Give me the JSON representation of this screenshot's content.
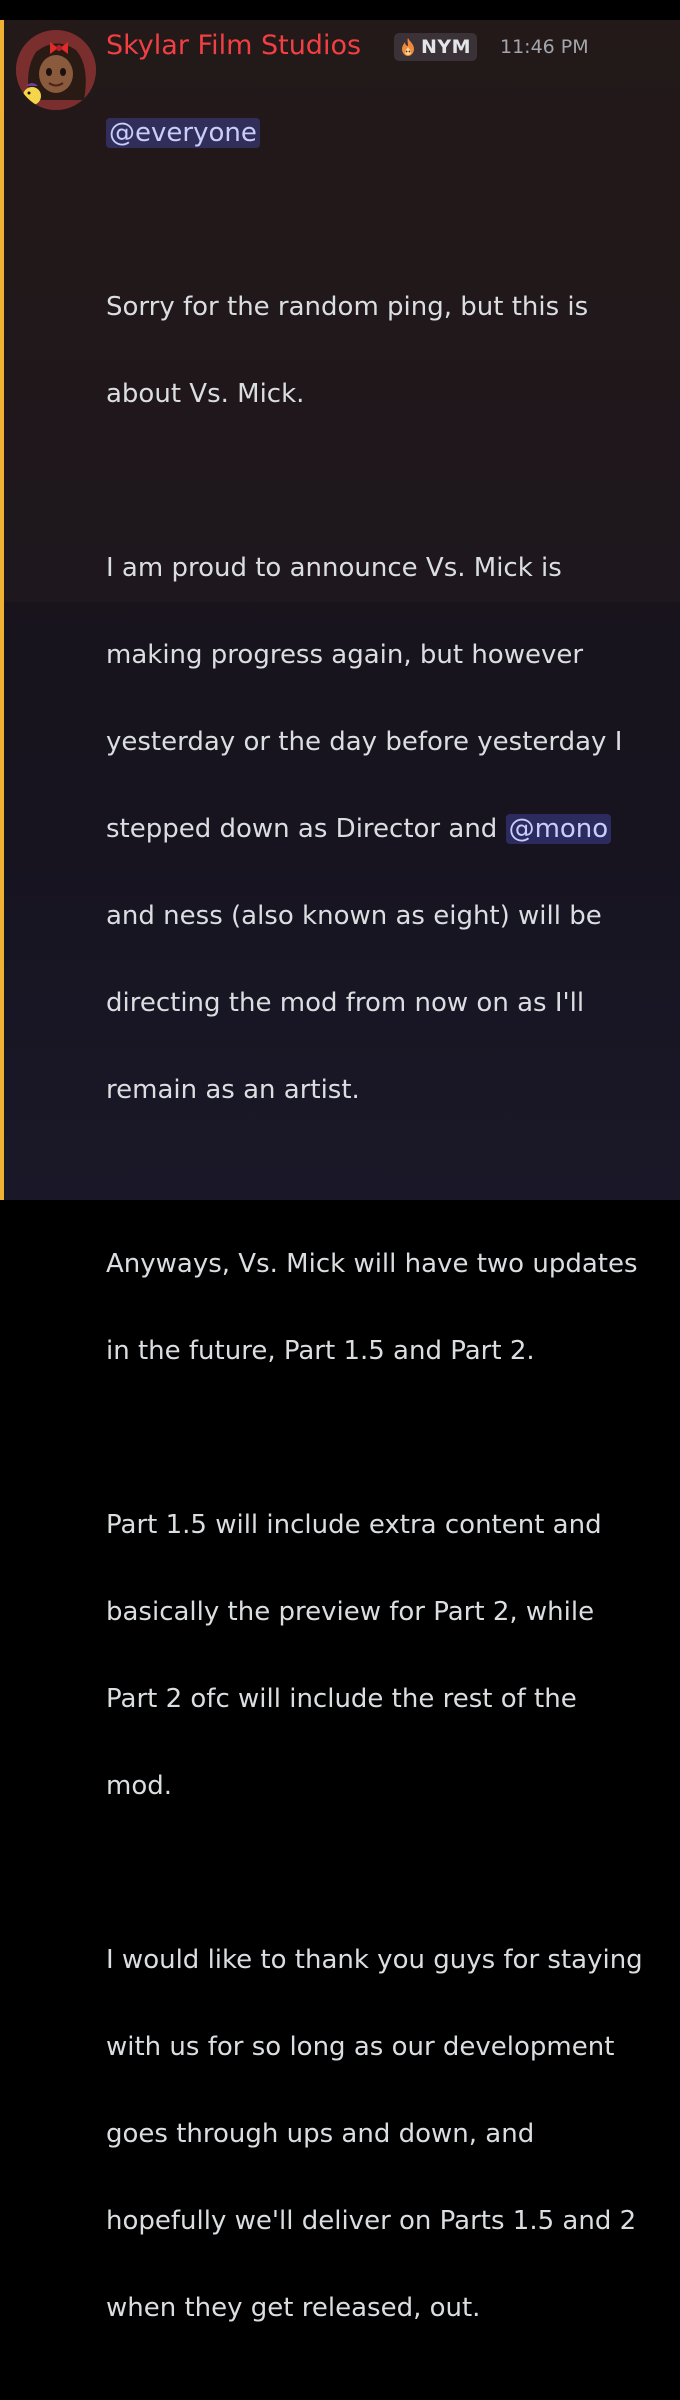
{
  "message": {
    "author": "Skylar Film Studios",
    "tag": "NYM",
    "timestamp": "11:46 PM",
    "mention_everyone": "@everyone",
    "paragraphs": {
      "p1": {
        "l1": "Sorry for the random ping, but this is",
        "l2": "about Vs. Mick."
      },
      "p2": {
        "l1": "I am proud to announce Vs. Mick is",
        "l2": "making progress again, but however",
        "l3": "yesterday or the day before yesterday I",
        "l4_pre": "stepped down as Director and ",
        "l4_mention": "@mono",
        "l5": "and ness (also known as eight) will be",
        "l6": "directing the mod from now on as I'll",
        "l7": "remain as an artist."
      },
      "p3": {
        "l1": "Anyways, Vs. Mick will have two updates",
        "l2": "in the future, Part 1.5 and Part 2."
      },
      "p4": {
        "l1": "Part 1.5 will include extra content and",
        "l2": "basically the preview for Part 2, while",
        "l3": "Part 2 ofc will include the rest of the",
        "l4": "mod."
      },
      "p5": {
        "l1": "I would like to thank you guys for staying",
        "l2": "with us for so long as our development",
        "l3": "goes through ups and down, and",
        "l4": "hopefully we'll deliver on Parts 1.5 and 2",
        "l5": "when they get released, out."
      }
    }
  },
  "colors": {
    "author": "#f23f43",
    "highlight_bar": "#f0b232",
    "mention_bg": "#5865f2",
    "text": "#dbdee1",
    "timestamp": "#a3a6ad"
  },
  "icons": {
    "avatar": "avatar-image",
    "tag": "fire-icon"
  }
}
